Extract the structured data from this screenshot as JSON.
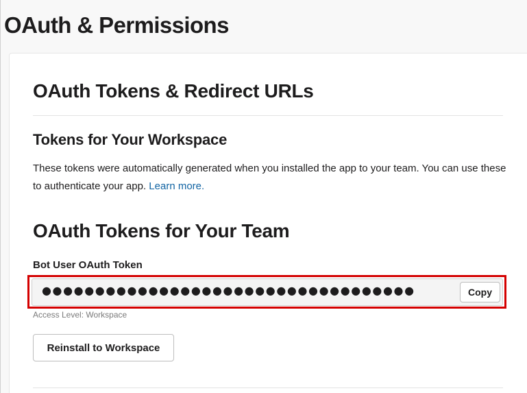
{
  "page": {
    "title": "OAuth & Permissions"
  },
  "section": {
    "title": "OAuth Tokens & Redirect URLs"
  },
  "workspace_tokens": {
    "title": "Tokens for Your Workspace",
    "description": "These tokens were automatically generated when you installed the app to your team. You can use these to authenticate your app. ",
    "learn_more": "Learn more."
  },
  "team_tokens": {
    "title": "OAuth Tokens for Your Team",
    "bot_token": {
      "label": "Bot User OAuth Token",
      "masked_value": "●●●●●●●●●●●●●●●●●●●●●●●●●●●●●●●●●●●",
      "copy_label": "Copy",
      "access_level": "Access Level: Workspace"
    },
    "reinstall_label": "Reinstall to Workspace"
  },
  "colors": {
    "highlight_border": "#d40000",
    "link": "#1264a3",
    "text": "#1d1c1d"
  }
}
